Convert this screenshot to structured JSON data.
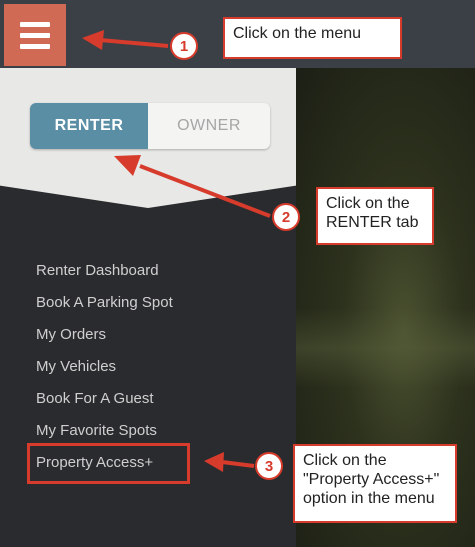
{
  "header": {
    "menu_icon": "hamburger-menu-icon"
  },
  "sidebar": {
    "toggle": {
      "renter_label": "RENTER",
      "owner_label": "OWNER"
    },
    "items": [
      {
        "label": "Renter Dashboard"
      },
      {
        "label": "Book A Parking Spot"
      },
      {
        "label": "My Orders"
      },
      {
        "label": "My Vehicles"
      },
      {
        "label": "Book For A Guest"
      },
      {
        "label": "My Favorite Spots"
      },
      {
        "label": "Property Access+"
      }
    ]
  },
  "annotations": [
    {
      "number": "1",
      "text": "Click on the menu"
    },
    {
      "number": "2",
      "text": "Click on the RENTER tab"
    },
    {
      "number": "3",
      "text": "Click on the \"Property Access+\" option in the menu"
    }
  ],
  "colors": {
    "menu_button": "#d06a55",
    "renter_active": "#5a8ea5",
    "annotation_red": "#d63b2c",
    "sidebar_bg": "#2a2b2e"
  }
}
